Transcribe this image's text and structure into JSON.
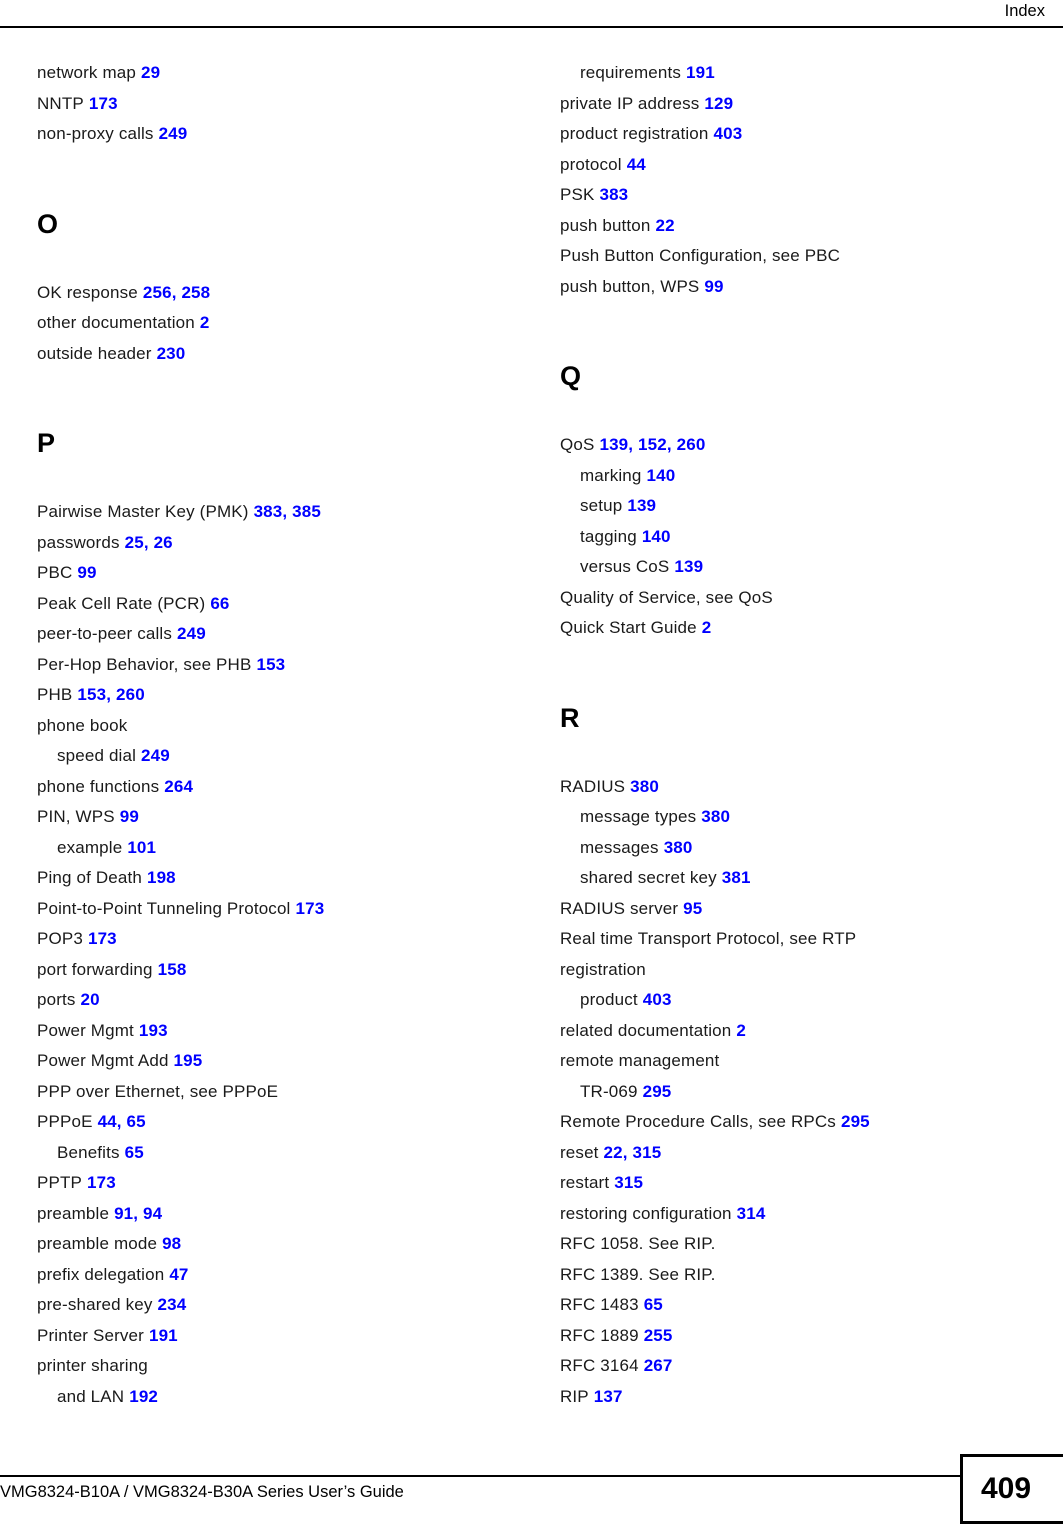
{
  "header": {
    "title": "Index"
  },
  "footer": {
    "guide_title": "VMG8324-B10A / VMG8324-B30A Series User’s Guide",
    "page_number": "409"
  },
  "colors": {
    "page_reference": "#0000ff",
    "text": "#1a1a1a",
    "rule": "#000000"
  },
  "columns": {
    "left": [
      {
        "type": "entry",
        "term": "network map",
        "pages": [
          "29"
        ],
        "indent": 0
      },
      {
        "type": "entry",
        "term": "NNTP",
        "pages": [
          "173"
        ],
        "indent": 0
      },
      {
        "type": "entry",
        "term": "non-proxy calls",
        "pages": [
          "249"
        ],
        "indent": 0
      },
      {
        "type": "letter",
        "letter": "O"
      },
      {
        "type": "entry",
        "term": "OK response",
        "pages": [
          "256",
          "258"
        ],
        "indent": 0
      },
      {
        "type": "entry",
        "term": "other documentation",
        "pages": [
          "2"
        ],
        "indent": 0
      },
      {
        "type": "entry",
        "term": "outside header",
        "pages": [
          "230"
        ],
        "indent": 0
      },
      {
        "type": "letter",
        "letter": "P"
      },
      {
        "type": "entry",
        "term": "Pairwise Master Key (PMK)",
        "pages": [
          "383",
          "385"
        ],
        "indent": 0
      },
      {
        "type": "entry",
        "term": "passwords",
        "pages": [
          "25",
          "26"
        ],
        "indent": 0
      },
      {
        "type": "entry",
        "term": "PBC",
        "pages": [
          "99"
        ],
        "indent": 0
      },
      {
        "type": "entry",
        "term": "Peak Cell Rate (PCR)",
        "pages": [
          "66"
        ],
        "indent": 0
      },
      {
        "type": "entry",
        "term": "peer-to-peer calls",
        "pages": [
          "249"
        ],
        "indent": 0
      },
      {
        "type": "entry",
        "term": "Per-Hop Behavior, see PHB",
        "pages": [
          "153"
        ],
        "indent": 0
      },
      {
        "type": "entry",
        "term": "PHB",
        "pages": [
          "153",
          "260"
        ],
        "indent": 0
      },
      {
        "type": "entry",
        "term": "phone book",
        "pages": [],
        "indent": 0
      },
      {
        "type": "entry",
        "term": "speed dial",
        "pages": [
          "249"
        ],
        "indent": 1
      },
      {
        "type": "entry",
        "term": "phone functions",
        "pages": [
          "264"
        ],
        "indent": 0
      },
      {
        "type": "entry",
        "term": "PIN, WPS",
        "pages": [
          "99"
        ],
        "indent": 0
      },
      {
        "type": "entry",
        "term": "example",
        "pages": [
          "101"
        ],
        "indent": 1
      },
      {
        "type": "entry",
        "term": "Ping of Death",
        "pages": [
          "198"
        ],
        "indent": 0
      },
      {
        "type": "entry",
        "term": "Point-to-Point Tunneling Protocol",
        "pages": [
          "173"
        ],
        "indent": 0
      },
      {
        "type": "entry",
        "term": "POP3",
        "pages": [
          "173"
        ],
        "indent": 0
      },
      {
        "type": "entry",
        "term": "port forwarding",
        "pages": [
          "158"
        ],
        "indent": 0
      },
      {
        "type": "entry",
        "term": "ports",
        "pages": [
          "20"
        ],
        "indent": 0
      },
      {
        "type": "entry",
        "term": "Power Mgmt",
        "pages": [
          "193"
        ],
        "indent": 0
      },
      {
        "type": "entry",
        "term": "Power Mgmt Add",
        "pages": [
          "195"
        ],
        "indent": 0
      },
      {
        "type": "entry",
        "term": "PPP over Ethernet, see PPPoE",
        "pages": [],
        "indent": 0
      },
      {
        "type": "entry",
        "term": "PPPoE",
        "pages": [
          "44",
          "65"
        ],
        "indent": 0
      },
      {
        "type": "entry",
        "term": "Benefits",
        "pages": [
          "65"
        ],
        "indent": 1
      },
      {
        "type": "entry",
        "term": "PPTP",
        "pages": [
          "173"
        ],
        "indent": 0
      },
      {
        "type": "entry",
        "term": "preamble",
        "pages": [
          "91",
          "94"
        ],
        "indent": 0
      },
      {
        "type": "entry",
        "term": "preamble mode",
        "pages": [
          "98"
        ],
        "indent": 0
      },
      {
        "type": "entry",
        "term": "prefix delegation",
        "pages": [
          "47"
        ],
        "indent": 0
      },
      {
        "type": "entry",
        "term": "pre-shared key",
        "pages": [
          "234"
        ],
        "indent": 0
      },
      {
        "type": "entry",
        "term": "Printer Server",
        "pages": [
          "191"
        ],
        "indent": 0
      },
      {
        "type": "entry",
        "term": "printer sharing",
        "pages": [],
        "indent": 0
      },
      {
        "type": "entry",
        "term": "and LAN",
        "pages": [
          "192"
        ],
        "indent": 1
      }
    ],
    "right": [
      {
        "type": "entry",
        "term": "requirements",
        "pages": [
          "191"
        ],
        "indent": 1
      },
      {
        "type": "entry",
        "term": "private IP address",
        "pages": [
          "129"
        ],
        "indent": 0
      },
      {
        "type": "entry",
        "term": "product registration",
        "pages": [
          "403"
        ],
        "indent": 0
      },
      {
        "type": "entry",
        "term": "protocol",
        "pages": [
          "44"
        ],
        "indent": 0
      },
      {
        "type": "entry",
        "term": "PSK",
        "pages": [
          "383"
        ],
        "indent": 0
      },
      {
        "type": "entry",
        "term": "push button",
        "pages": [
          "22"
        ],
        "indent": 0
      },
      {
        "type": "entry",
        "term": "Push Button Configuration, see PBC",
        "pages": [],
        "indent": 0
      },
      {
        "type": "entry",
        "term": "push button, WPS",
        "pages": [
          "99"
        ],
        "indent": 0
      },
      {
        "type": "letter",
        "letter": "Q"
      },
      {
        "type": "entry",
        "term": "QoS",
        "pages": [
          "139",
          "152",
          "260"
        ],
        "indent": 0
      },
      {
        "type": "entry",
        "term": "marking",
        "pages": [
          "140"
        ],
        "indent": 1
      },
      {
        "type": "entry",
        "term": "setup",
        "pages": [
          "139"
        ],
        "indent": 1
      },
      {
        "type": "entry",
        "term": "tagging",
        "pages": [
          "140"
        ],
        "indent": 1
      },
      {
        "type": "entry",
        "term": "versus CoS",
        "pages": [
          "139"
        ],
        "indent": 1
      },
      {
        "type": "entry",
        "term": "Quality of Service, see QoS",
        "pages": [],
        "indent": 0
      },
      {
        "type": "entry",
        "term": "Quick Start Guide",
        "pages": [
          "2"
        ],
        "indent": 0
      },
      {
        "type": "letter",
        "letter": "R"
      },
      {
        "type": "entry",
        "term": "RADIUS",
        "pages": [
          "380"
        ],
        "indent": 0
      },
      {
        "type": "entry",
        "term": "message types",
        "pages": [
          "380"
        ],
        "indent": 1
      },
      {
        "type": "entry",
        "term": "messages",
        "pages": [
          "380"
        ],
        "indent": 1
      },
      {
        "type": "entry",
        "term": "shared secret key",
        "pages": [
          "381"
        ],
        "indent": 1
      },
      {
        "type": "entry",
        "term": "RADIUS server",
        "pages": [
          "95"
        ],
        "indent": 0
      },
      {
        "type": "entry",
        "term": "Real time Transport Protocol, see RTP",
        "pages": [],
        "indent": 0
      },
      {
        "type": "entry",
        "term": "registration",
        "pages": [],
        "indent": 0
      },
      {
        "type": "entry",
        "term": "product",
        "pages": [
          "403"
        ],
        "indent": 1
      },
      {
        "type": "entry",
        "term": "related documentation",
        "pages": [
          "2"
        ],
        "indent": 0
      },
      {
        "type": "entry",
        "term": "remote management",
        "pages": [],
        "indent": 0
      },
      {
        "type": "entry",
        "term": "TR-069",
        "pages": [
          "295"
        ],
        "indent": 1
      },
      {
        "type": "entry",
        "term": "Remote Procedure Calls, see RPCs",
        "pages": [
          "295"
        ],
        "indent": 0
      },
      {
        "type": "entry",
        "term": "reset",
        "pages": [
          "22",
          "315"
        ],
        "indent": 0
      },
      {
        "type": "entry",
        "term": "restart",
        "pages": [
          "315"
        ],
        "indent": 0
      },
      {
        "type": "entry",
        "term": "restoring configuration",
        "pages": [
          "314"
        ],
        "indent": 0
      },
      {
        "type": "entry",
        "term": "RFC 1058. See RIP.",
        "pages": [],
        "indent": 0
      },
      {
        "type": "entry",
        "term": "RFC 1389. See RIP.",
        "pages": [],
        "indent": 0
      },
      {
        "type": "entry",
        "term": "RFC 1483",
        "pages": [
          "65"
        ],
        "indent": 0
      },
      {
        "type": "entry",
        "term": "RFC 1889",
        "pages": [
          "255"
        ],
        "indent": 0
      },
      {
        "type": "entry",
        "term": "RFC 3164",
        "pages": [
          "267"
        ],
        "indent": 0
      },
      {
        "type": "entry",
        "term": "RIP",
        "pages": [
          "137"
        ],
        "indent": 0
      }
    ]
  }
}
